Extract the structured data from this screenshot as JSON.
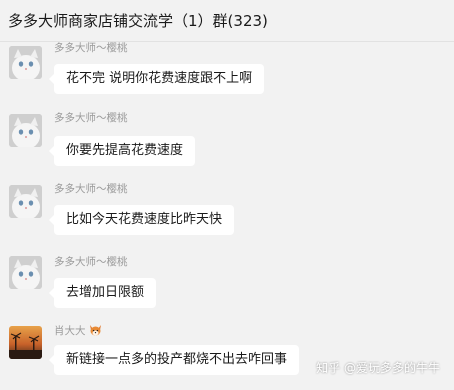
{
  "window": {
    "title": "多多大师商家店铺交流学（1）群(323)"
  },
  "messages": [
    {
      "sender": "多多大师～樱桃",
      "text": "花不完 说明你花费速度跟不上啊",
      "avatar": "white-cat-avatar"
    },
    {
      "sender": "多多大师～樱桃",
      "text": "你要先提高花费速度",
      "avatar": "white-cat-avatar"
    },
    {
      "sender": "多多大师～樱桃",
      "text": "比如今天花费速度比昨天快",
      "avatar": "white-cat-avatar"
    },
    {
      "sender": "多多大师～樱桃",
      "text": "去增加日限额",
      "avatar": "white-cat-avatar"
    },
    {
      "sender": "肖大大",
      "text": "新链接一点多的投产都烧不出去咋回事",
      "avatar": "sunset-avatar",
      "badge": "fox-emoji-icon"
    }
  ],
  "watermark": "知乎 @爱玩多多的牛牛",
  "colors": {
    "background": "#f2f2f2",
    "bubble": "#ffffff",
    "sender": "#9a9a9a"
  }
}
